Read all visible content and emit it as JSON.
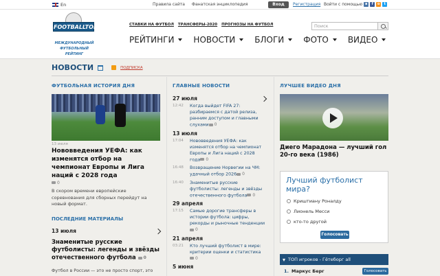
{
  "topbar": {
    "lang": "En",
    "links": [
      "Правила сайта",
      "Фанатская энциклопедия"
    ],
    "login": "Вход",
    "register": "Регистрация",
    "social_label": "Войти с помощью"
  },
  "header": {
    "logo_text": "FOOTBALLTOP.RU",
    "tagline": "МЕЖДУНАРОДНЫЙ ФУТБОЛЬНЫЙ РЕЙТИНГ",
    "sublinks": [
      "СТАВКИ НА ФУТБОЛ",
      "ТРАНСФЕРЫ-2020",
      "ПРОГНОЗЫ НА ФУТБОЛ"
    ],
    "nav": [
      "РЕЙТИНГИ",
      "НОВОСТИ",
      "БЛОГИ",
      "ФОТО",
      "ВИДЕО"
    ],
    "search_placeholder": "Поиск"
  },
  "page": {
    "title": "НОВОСТИ",
    "subscribe": "ПОДПИСКА"
  },
  "story": {
    "heading": "ФУТБОЛЬНАЯ ИСТОРИЯ ДНЯ",
    "date": "13 июля",
    "title": "Нововведения УЕФА: как изменятся отбор на чемпионат Европы и Лига наций с 2028 года",
    "comments": "0",
    "lead": "В скором времени европейские соревнования для сборных перейдут на новый формат."
  },
  "latest": {
    "heading": "ПОСЛЕДНИЕ МАТЕРИАЛЫ",
    "date": "13 июля",
    "title": "Знаменитые русские футболисты: легенды и звёзды отечественного футбола",
    "comments": "0",
    "snippet": "Футбол в России — это не просто спорт, это"
  },
  "news": {
    "heading": "ГЛАВНЫЕ НОВОСТИ",
    "groups": [
      {
        "date": "27 июля",
        "items": [
          {
            "time": "12:42",
            "text": "Когда выйдет FIFA 27: разбираемся с датой релиза, ранним доступом и главными слухами",
            "comments": "0"
          }
        ]
      },
      {
        "date": "13 июля",
        "items": [
          {
            "time": "17:04",
            "text": "Нововведения УЕФА: как изменятся отбор на чемпионат Европы и Лига наций с 2028 года",
            "comments": "0"
          },
          {
            "time": "16:48",
            "text": "Возвращение Норвегии на ЧМ: удачный отбор 2026",
            "comments": "0"
          },
          {
            "time": "16:40",
            "text": "Знаменитые русские футболисты: легенды и звёзды отечественного футбола",
            "comments": "0"
          }
        ]
      },
      {
        "date": "29 апреля",
        "items": [
          {
            "time": "17:15",
            "text": "Самые дорогие трансферы в истории футбола: цифры, рекорды и рыночные тенденции",
            "comments": "0"
          }
        ]
      },
      {
        "date": "21 апреля",
        "items": [
          {
            "time": "03:21",
            "text": "Кто лучший футболист в мире: критерии оценки и статистика",
            "comments": "0"
          }
        ]
      },
      {
        "date": "5 июня",
        "items": []
      }
    ]
  },
  "video": {
    "heading": "ЛУЧШЕЕ ВИДЕО ДНЯ",
    "title": "Диего Марадона — лучший гол 20-го века (1986)"
  },
  "poll": {
    "question": "Лучший футболист мира?",
    "options": [
      "Криштиану Роналду",
      "Лионель Месси",
      "кто-то другой"
    ],
    "vote": "Голосовать"
  },
  "top_players": {
    "title": "ТОП игроков - Гётеборг all",
    "row_num": "1.",
    "row_name": "Маркус Берг",
    "row_btn": "Голосовать"
  }
}
